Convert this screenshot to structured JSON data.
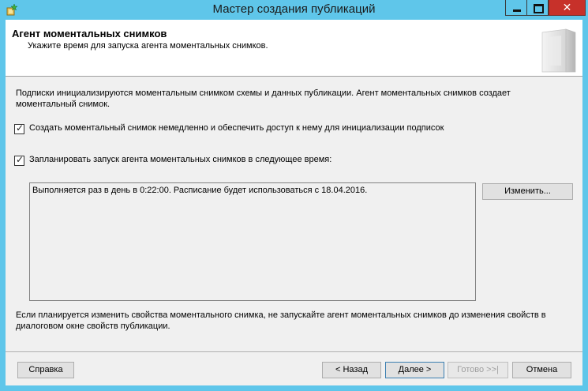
{
  "window": {
    "title": "Мастер создания публикаций",
    "close_glyph": "✕"
  },
  "header": {
    "title": "Агент моментальных снимков",
    "subtitle": "Укажите время для запуска агента моментальных снимков."
  },
  "intro_text": "Подписки инициализируются моментальным снимком схемы и данных публикации. Агент моментальных снимков создает моментальный снимок.",
  "options": {
    "create_now": {
      "label": "Создать моментальный снимок немедленно и обеспечить доступ к нему для инициализации подписок",
      "checked": true
    },
    "schedule": {
      "label": "Запланировать запуск агента моментальных снимков в следующее время:",
      "checked": true
    }
  },
  "schedule_description": "Выполняется раз в день в 0:22:00. Расписание будет использоваться с 18.04.2016.",
  "change_button": "Изменить...",
  "note_text": "Если планируется изменить свойства моментального снимка, не запускайте агент моментальных снимков до изменения свойств в диалоговом окне свойств публикации.",
  "footer": {
    "help": "Справка",
    "back": "< Назад",
    "next": "Далее >",
    "finish": "Готово >>|",
    "cancel": "Отмена"
  },
  "colors": {
    "title_bar": "#5fc6ea",
    "close_button": "#c7312a",
    "dialog_bg": "#f0f0f0"
  }
}
